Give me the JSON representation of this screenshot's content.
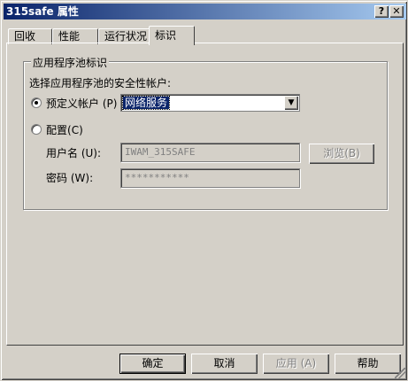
{
  "window": {
    "title": "315safe 属性",
    "help_label": "?",
    "close_label": "✕"
  },
  "tabs": [
    {
      "label": "回收",
      "active": false
    },
    {
      "label": "性能",
      "active": false
    },
    {
      "label": "运行状况",
      "active": false
    },
    {
      "label": "标识",
      "active": true
    }
  ],
  "identity": {
    "group_title": "应用程序池标识",
    "prompt": "选择应用程序池的安全性帐户:",
    "predefined_label": "预定义帐户",
    "predefined_key": "(P)",
    "predefined_selected": true,
    "predefined_value": "网络服务",
    "configurable_label": "配置",
    "configurable_key": "(C)",
    "configurable_selected": false,
    "username_label": "用户名",
    "username_key": "(U):",
    "username_value": "IWAM_315SAFE",
    "password_label": "密码",
    "password_key": "(W):",
    "password_value": "***********",
    "browse_label": "浏览",
    "browse_key": "(B)"
  },
  "footer": {
    "ok_label": "确定",
    "cancel_label": "取消",
    "apply_label": "应用",
    "apply_key": "(A)",
    "help_label": "帮助"
  },
  "colors": {
    "titlebar_start": "#0a246a",
    "titlebar_end": "#a6caf0",
    "face": "#d4d0c8",
    "selection": "#0a246a"
  }
}
